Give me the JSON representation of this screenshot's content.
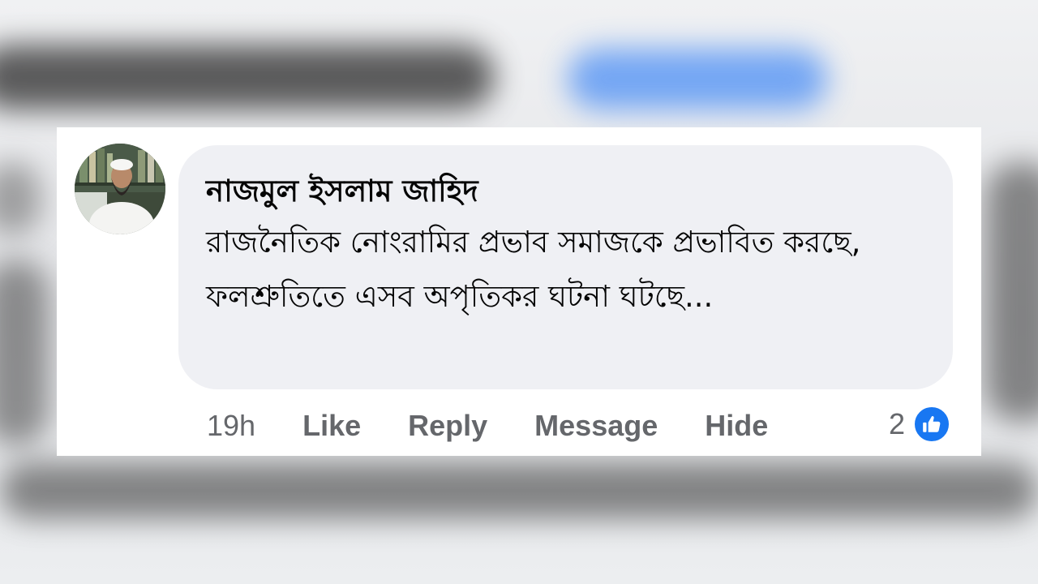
{
  "comment": {
    "author": "নাজমুল ইসলাম জাহিদ",
    "text": "রাজনৈতিক নোংরামির প্রভাব সমাজকে প্রভাবিত করছে, ফলশ্রুতিতে এসব অপৃতিকর ঘটনা ঘটছে...",
    "time": "19h",
    "actions": {
      "like": "Like",
      "reply": "Reply",
      "message": "Message",
      "hide": "Hide"
    },
    "reaction_count": "2",
    "reaction_icon": "thumbs-up-icon"
  },
  "colors": {
    "bubble": "#eff0f4",
    "action_text": "#65676b",
    "like_blue": "#1877f2",
    "background_blurred_follow": "#4b8ef5"
  }
}
